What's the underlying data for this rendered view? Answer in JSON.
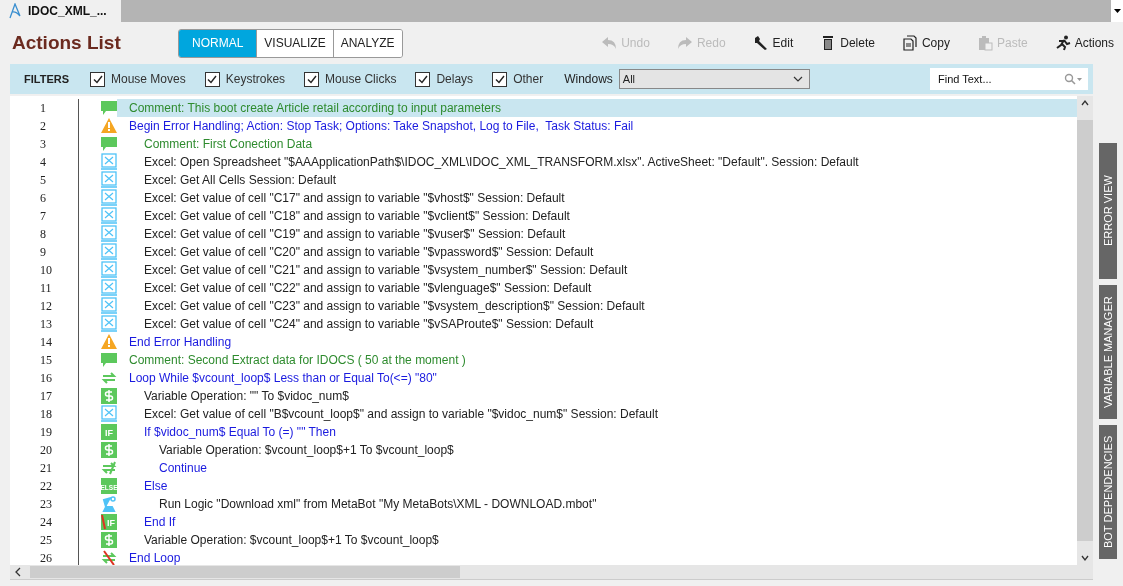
{
  "document_tab": {
    "title": "IDOC_XML_...",
    "selected": true
  },
  "header": {
    "title": "Actions List",
    "view_modes": [
      {
        "label": "NORMAL",
        "selected": true
      },
      {
        "label": "VISUALIZE",
        "selected": false
      },
      {
        "label": "ANALYZE",
        "selected": false
      }
    ],
    "toolbar": [
      {
        "kind": "undo",
        "label": "Undo",
        "disabled": true
      },
      {
        "kind": "redo",
        "label": "Redo",
        "disabled": true
      },
      {
        "kind": "edit",
        "label": "Edit",
        "disabled": false
      },
      {
        "kind": "delete",
        "label": "Delete",
        "disabled": false
      },
      {
        "kind": "copy",
        "label": "Copy",
        "disabled": false
      },
      {
        "kind": "paste",
        "label": "Paste",
        "disabled": true
      },
      {
        "kind": "actions",
        "label": "Actions",
        "disabled": false
      }
    ]
  },
  "filters": {
    "label": "FILTERS",
    "options": [
      {
        "label": "Mouse Moves",
        "checked": true
      },
      {
        "label": "Keystrokes",
        "checked": true
      },
      {
        "label": "Mouse Clicks",
        "checked": true
      },
      {
        "label": "Delays",
        "checked": true
      },
      {
        "label": "Other",
        "checked": true
      }
    ],
    "windows_label": "Windows",
    "windows_value": "All",
    "search": {
      "placeholder": "Find Text..."
    }
  },
  "actions": [
    {
      "number": "1",
      "kind": "comment",
      "text": "Comment: This boot create Article retail according to input parameters",
      "selected": true
    },
    {
      "number": "2",
      "kind": "error",
      "text": "Begin Error Handling; Action: Stop Task; Options: Take Snapshot, Log to File,  Task Status: Fail",
      "selected": false,
      "children": [
        {
          "number": "3",
          "kind": "comment",
          "text": "Comment: First Conection Data",
          "selected": false
        },
        {
          "number": "4",
          "kind": "excel",
          "text": "Excel: Open Spreadsheet \"$AAApplicationPath$\\IDOC_XML\\IDOC_XML_TRANSFORM.xlsx\". ActiveSheet: \"Default\". Session: Default",
          "selected": false
        },
        {
          "number": "5",
          "kind": "excel",
          "text": "Excel: Get All Cells Session: Default",
          "selected": false
        },
        {
          "number": "6",
          "kind": "excel",
          "text": "Excel: Get value of cell \"C17\" and assign to variable \"$vhost$\" Session: Default",
          "selected": false
        },
        {
          "number": "7",
          "kind": "excel",
          "text": "Excel: Get value of cell \"C18\" and assign to variable \"$vclient$\" Session: Default",
          "selected": false
        },
        {
          "number": "8",
          "kind": "excel",
          "text": "Excel: Get value of cell \"C19\" and assign to variable \"$vuser$\" Session: Default",
          "selected": false
        },
        {
          "number": "9",
          "kind": "excel",
          "text": "Excel: Get value of cell \"C20\" and assign to variable \"$vpassword$\" Session: Default",
          "selected": false
        },
        {
          "number": "10",
          "kind": "excel",
          "text": "Excel: Get value of cell \"C21\" and assign to variable \"$vsystem_number$\" Session: Default",
          "selected": false
        },
        {
          "number": "11",
          "kind": "excel",
          "text": "Excel: Get value of cell \"C22\" and assign to variable \"$vlenguage$\" Session: Default",
          "selected": false
        },
        {
          "number": "12",
          "kind": "excel",
          "text": "Excel: Get value of cell \"C23\" and assign to variable \"$vsystem_description$\" Session: Default",
          "selected": false
        },
        {
          "number": "13",
          "kind": "excel",
          "text": "Excel: Get value of cell \"C24\" and assign to variable \"$vSAProute$\" Session: Default",
          "selected": false
        }
      ]
    },
    {
      "number": "14",
      "kind": "error",
      "text": "End Error Handling",
      "selected": false
    },
    {
      "number": "15",
      "kind": "comment",
      "text": "Comment: Second Extract data for IDOCS ( 50 at the moment )",
      "selected": false
    },
    {
      "number": "16",
      "kind": "loop",
      "text": "Loop While $vcount_loop$ Less than or Equal To(<=) \"80\"",
      "selected": false,
      "children": [
        {
          "number": "17",
          "kind": "variable",
          "text": "Variable Operation: \"\" To $vidoc_num$",
          "selected": false
        },
        {
          "number": "18",
          "kind": "excel",
          "text": "Excel: Get value of cell \"B$vcount_loop$\" and assign to variable \"$vidoc_num$\" Session: Default",
          "selected": false
        },
        {
          "number": "19",
          "kind": "if",
          "icon_text": "IF",
          "text": "If $vidoc_num$ Equal To (=) \"\" Then",
          "selected": false,
          "children": [
            {
              "number": "20",
              "kind": "variable",
              "text": "Variable Operation: $vcount_loop$+1 To $vcount_loop$",
              "selected": false
            },
            {
              "number": "21",
              "kind": "continue",
              "text": "Continue",
              "selected": false
            }
          ]
        },
        {
          "number": "22",
          "kind": "else",
          "icon_text": "ELSE",
          "text": "Else",
          "selected": false,
          "children": [
            {
              "number": "23",
              "kind": "metabot",
              "text": "Run Logic \"Download xml\" from MetaBot \"My MetaBots\\XML - DOWNLOAD.mbot\"",
              "selected": false
            }
          ]
        },
        {
          "number": "24",
          "kind": "endif",
          "icon_text": "IF",
          "text": "End If",
          "selected": false
        },
        {
          "number": "25",
          "kind": "variable",
          "text": "Variable Operation: $vcount_loop$+1 To $vcount_loop$",
          "selected": false
        }
      ]
    },
    {
      "number": "26",
      "kind": "endloop",
      "text": "End Loop",
      "selected": false
    }
  ],
  "side_tabs": [
    {
      "label": "ERROR VIEW"
    },
    {
      "label": "VARIABLE MANAGER"
    },
    {
      "label": "BOT DEPENDENCIES"
    }
  ]
}
